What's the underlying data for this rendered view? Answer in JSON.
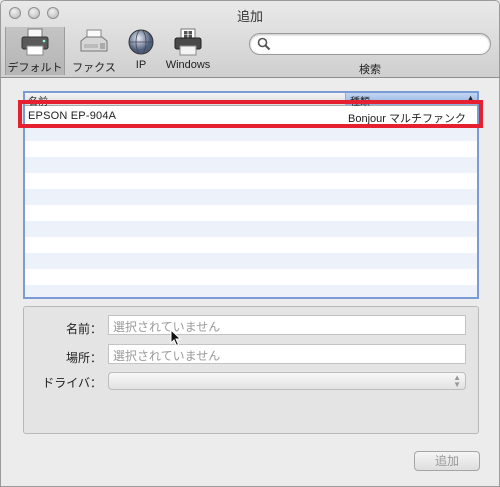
{
  "window": {
    "title": "追加"
  },
  "toolbar": {
    "items": [
      {
        "label": "デフォルト",
        "icon": "default-printer-icon"
      },
      {
        "label": "ファクス",
        "icon": "fax-icon"
      },
      {
        "label": "IP",
        "icon": "ip-globe-icon"
      },
      {
        "label": "Windows",
        "icon": "windows-printer-icon"
      }
    ],
    "search": {
      "placeholder": "",
      "label": "検索"
    }
  },
  "printer_list": {
    "columns": [
      "名前",
      "種類"
    ],
    "rows": [
      {
        "name": "EPSON EP-904A",
        "kind": "Bonjour マルチファンク"
      }
    ]
  },
  "details": {
    "name_label": "名前：",
    "name_value": "選択されていません",
    "location_label": "場所：",
    "location_value": "選択されていません",
    "driver_label": "ドライバ："
  },
  "footer": {
    "add_button": "追加"
  },
  "colors": {
    "highlight": "#e52131",
    "list_border": "#7c9bd6",
    "sort_header": "#8fb0e0"
  }
}
